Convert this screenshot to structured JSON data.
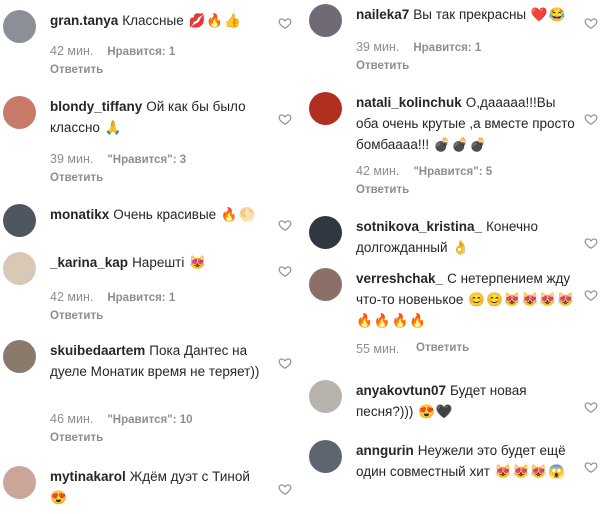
{
  "left_comments": [
    {
      "user": "gran.tanya",
      "text": "Классные",
      "emoji": "💋🔥👍",
      "time": "42 мин.",
      "likes": "Нравится: 1",
      "reply": "Ответить",
      "avatar": "#8a8f98"
    },
    {
      "user": "blondy_tiffany",
      "text": "Ой как бы было классно",
      "emoji": "🙏",
      "time": "39 мин.",
      "likes": "\"Нравится\": 3",
      "reply": "Ответить",
      "avatar": "#c77a6a"
    },
    {
      "user": "monatikx",
      "text": "Очень красивые",
      "emoji": "🔥🌕",
      "time": "",
      "likes": "",
      "reply": "",
      "avatar": "#4e5660"
    },
    {
      "user": "_karina_kap",
      "text": "Нарешті",
      "emoji": "😻",
      "time": "42 мин.",
      "likes": "Нравится: 1",
      "reply": "Ответить",
      "avatar": "#d9c8b5"
    },
    {
      "user": "skuibedaartem",
      "text": "Пока Дантес на дуеле Монатик время не теряет))",
      "emoji": "",
      "time": "46 мин.",
      "likes": "\"Нравится\": 10",
      "reply": "Ответить",
      "avatar": "#8a7a6c"
    },
    {
      "user": "mytinakarol",
      "text": "Ждём дуэт с Тиной",
      "emoji": "😍",
      "time": "",
      "likes": "",
      "reply": "",
      "avatar": "#c9a59a"
    }
  ],
  "right_comments": [
    {
      "user": "naileka7",
      "text": "Вы так прекрасны",
      "emoji": "❤️😂",
      "time": "39 мин.",
      "likes": "Нравится: 1",
      "reply": "Ответить",
      "avatar": "#6f6a75"
    },
    {
      "user": "natali_kolinchuk",
      "text": "О,дааааа!!!Вы оба очень крутые ,а вместе просто бомбаааа!!!",
      "emoji": "💣💣💣",
      "time": "42 мин.",
      "likes": "\"Нравится\": 5",
      "reply": "Ответить",
      "avatar": "#b0301f"
    },
    {
      "user": "sotnikova_kristina_",
      "text": "Конечно долгожданный",
      "emoji": "👌",
      "time": "",
      "likes": "",
      "reply": "",
      "avatar": "#2f3840"
    },
    {
      "user": "verreshchak_",
      "text": "С нетерпением жду что-то новенькое",
      "emoji": "😊😊😻😻😻😻🔥🔥🔥🔥",
      "time": "55 мин.",
      "likes": "",
      "reply": "Ответить",
      "avatar": "#8c7068"
    },
    {
      "user": "anyakovtun07",
      "text": "Будет новая песня?)))",
      "emoji": "😍🖤",
      "time": "",
      "likes": "",
      "reply": "",
      "avatar": "#b9b3ad"
    },
    {
      "user": "anngurin",
      "text": "Неужели это будет ещё один совместный хит",
      "emoji": "😻😻😻😱",
      "time": "",
      "likes": "",
      "reply": "",
      "avatar": "#5d6670"
    }
  ],
  "icons": {
    "like": "heart-outline-icon"
  }
}
